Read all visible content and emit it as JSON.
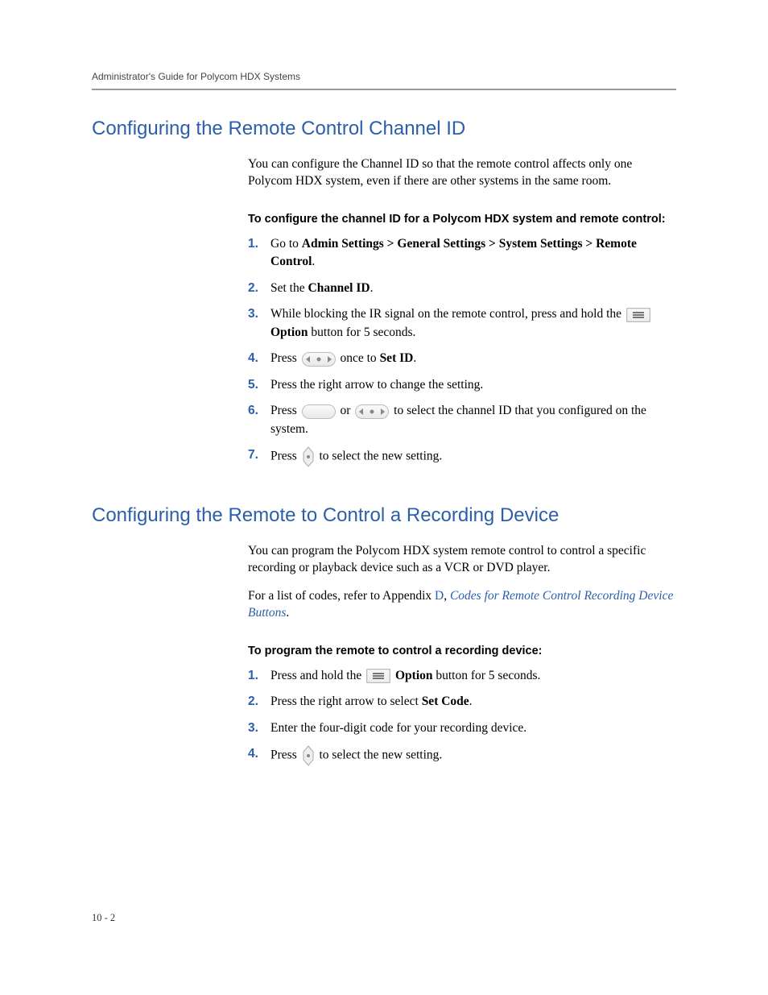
{
  "header": {
    "title": "Administrator's Guide for Polycom HDX Systems"
  },
  "section1": {
    "heading": "Configuring the Remote Control Channel ID",
    "intro": "You can configure the Channel ID so that the remote control affects only one Polycom HDX system, even if there are other systems in the same room.",
    "sub": "To configure the channel ID for a Polycom HDX system and remote control:",
    "step1_a": "Go to ",
    "step1_b": "Admin Settings > General Settings > System Settings > Remote Control",
    "step1_c": ".",
    "step2_a": "Set the ",
    "step2_b": "Channel ID",
    "step2_c": ".",
    "step3_a": "While blocking the IR signal on the remote control, press and hold the ",
    "step3_b": "Option",
    "step3_c": " button for 5 seconds.",
    "step4_a": "Press ",
    "step4_b": " once to ",
    "step4_c": "Set ID",
    "step4_d": ".",
    "step5": "Press the right arrow to change the setting.",
    "step6_a": "Press ",
    "step6_b": " or ",
    "step6_c": " to select the channel ID that you configured on the system.",
    "step7_a": "Press ",
    "step7_b": " to select the new setting."
  },
  "section2": {
    "heading": "Configuring the Remote to Control a Recording Device",
    "intro": "You can program the Polycom HDX system remote control to control a specific recording or playback device such as a VCR or DVD player.",
    "ref_a": "For a list of codes, refer to Appendix ",
    "ref_b": "D",
    "ref_c": ", ",
    "ref_link": "Codes for Remote Control Recording Device Buttons",
    "ref_d": ".",
    "sub": "To program the remote to control a recording device:",
    "step1_a": "Press and hold the ",
    "step1_b": "Option",
    "step1_c": " button for 5 seconds.",
    "step2_a": "Press the right arrow to select ",
    "step2_b": "Set Code",
    "step2_c": ".",
    "step3": "Enter the four-digit code for your recording device.",
    "step4_a": "Press ",
    "step4_b": " to select the new setting."
  },
  "page_number": "10 - 2"
}
